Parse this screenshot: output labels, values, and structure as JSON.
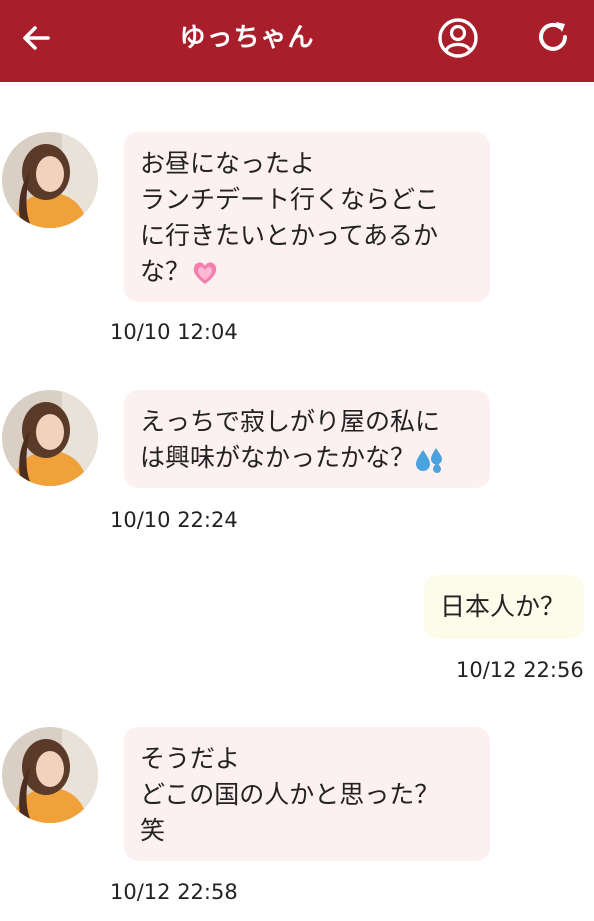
{
  "header": {
    "title": "ゆっちゃん",
    "back_icon": "arrow-left-icon",
    "profile_icon": "user-circle-icon",
    "refresh_icon": "refresh-icon",
    "color": "#a81e2a"
  },
  "messages": [
    {
      "side": "in",
      "text_lines": [
        "お昼になったよ",
        "ランチデート行くならどこ",
        "に行きたいとかってあるか",
        "な？"
      ],
      "emoji": "heart-icon",
      "time": "10/10 12:04"
    },
    {
      "side": "in",
      "text_lines": [
        "えっちで寂しがり屋の私に",
        "は興味がなかったかな？"
      ],
      "emoji": "sweat-drops-icon",
      "time": "10/10 22:24"
    },
    {
      "side": "out",
      "text_lines": [
        "日本人か？"
      ],
      "time": "10/12 22:56"
    },
    {
      "side": "in",
      "text_lines": [
        "そうだよ",
        "どこの国の人かと思った？",
        "笑"
      ],
      "time": "10/12 22:58"
    }
  ],
  "colors": {
    "incoming_bubble": "#fdf0f1",
    "outgoing_bubble": "#fdfbe9"
  }
}
